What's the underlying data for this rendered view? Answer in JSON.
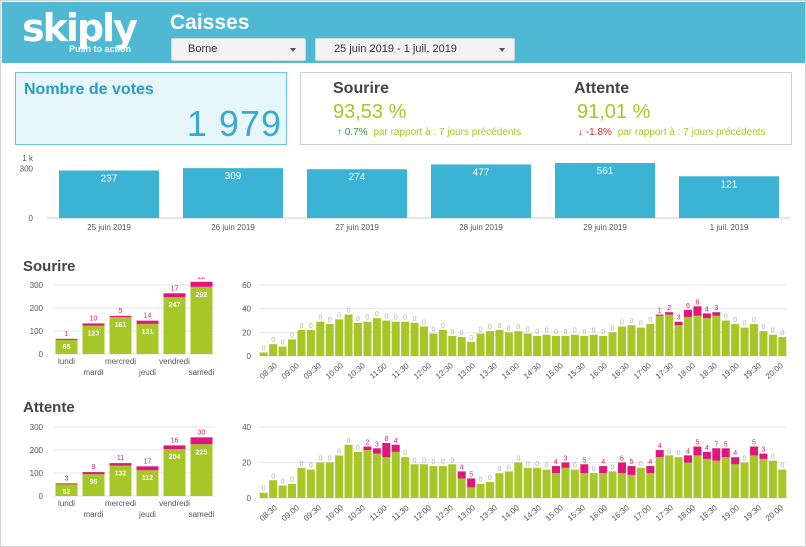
{
  "header": {
    "logo_text": "skiply",
    "logo_tagline": "Push to action",
    "title": "Caisses",
    "borne_dropdown": {
      "value": "Borne"
    },
    "date_dropdown": {
      "value": "25 juin 2019 - 1 juil. 2019"
    }
  },
  "votes_card": {
    "title": "Nombre de votes",
    "value": "1 979"
  },
  "kpis": {
    "sourire": {
      "title": "Sourire",
      "value": "93,53 %",
      "arrow": "↑",
      "delta": "0.7%",
      "comparison": "par rapport à : 7 jours précédents",
      "trend": "up"
    },
    "attente": {
      "title": "Attente",
      "value": "91,01 %",
      "arrow": "↓",
      "delta": "-1.8%",
      "comparison": "par rapport à : 7 jours précédents",
      "trend": "down"
    }
  },
  "sections": {
    "sourire_title": "Sourire",
    "attente_title": "Attente"
  },
  "colors": {
    "header_bg": "#4fb8d3",
    "blue_bar": "#3bb3d4",
    "positive_bar": "#a7c627",
    "negative_bar": "#e0177b",
    "axis_text": "#555555",
    "grid": "#e6e6e6"
  },
  "chart_data": [
    {
      "id": "daily",
      "type": "bar",
      "categories": [
        "25 juin 2019",
        "26 juin 2019",
        "27 juin 2019",
        "28 juin 2019",
        "29 juin 2019",
        "1 juil. 2019"
      ],
      "values": [
        237,
        309,
        274,
        477,
        561,
        121
      ],
      "y_ticks": [
        "0",
        "300",
        "1 k"
      ],
      "ylim": [
        0,
        1000
      ],
      "log_scale": true
    },
    {
      "id": "sourire_week",
      "type": "bar",
      "stacked": true,
      "categories": [
        "lundi",
        "mardi",
        "mercredi",
        "jeudi",
        "vendredi",
        "samedi"
      ],
      "series": [
        {
          "values": [
            65,
            123,
            161,
            131,
            247,
            292
          ]
        },
        {
          "values": [
            1,
            10,
            5,
            14,
            17,
            22
          ]
        }
      ],
      "y_ticks": [
        "0",
        "100",
        "200",
        "300"
      ],
      "ylim": [
        0,
        300
      ]
    },
    {
      "id": "sourire_hour",
      "type": "bar",
      "stacked": true,
      "x_tick_labels": [
        "08:30",
        "09:00",
        "09:30",
        "10:00",
        "10:30",
        "11:00",
        "11:30",
        "12:00",
        "12:30",
        "13:00",
        "13:30",
        "14:00",
        "14:30",
        "15:00",
        "15:30",
        "16:00",
        "16:30",
        "17:00",
        "17:30",
        "18:00",
        "18:30",
        "19:00",
        "19:30",
        "20:00"
      ],
      "series": [
        {
          "values": [
            3,
            10,
            8,
            14,
            22,
            22,
            29,
            27,
            31,
            35,
            28,
            29,
            32,
            30,
            29,
            29,
            28,
            25,
            19,
            22,
            17,
            16,
            12,
            19,
            21,
            22,
            20,
            21,
            19,
            17,
            18,
            17,
            17,
            18,
            17,
            18,
            17,
            20,
            25,
            26,
            24,
            27,
            34,
            35,
            26,
            33,
            34,
            32,
            34,
            30,
            27,
            24,
            27,
            21,
            18,
            16
          ]
        },
        {
          "values": [
            0,
            0,
            0,
            0,
            0,
            0,
            0,
            0,
            0,
            0,
            0,
            0,
            0,
            0,
            0,
            0,
            0,
            0,
            0,
            0,
            0,
            0,
            0,
            0,
            0,
            0,
            0,
            0,
            0,
            0,
            0,
            0,
            0,
            0,
            0,
            0,
            0,
            0,
            0,
            0,
            0,
            0,
            1,
            2,
            3,
            6,
            8,
            4,
            3,
            0,
            0,
            0,
            0,
            0,
            0,
            0
          ]
        }
      ],
      "y_ticks": [
        "0",
        "20",
        "40",
        "60"
      ],
      "ylim": [
        0,
        60
      ]
    },
    {
      "id": "attente_week",
      "type": "bar",
      "stacked": true,
      "categories": [
        "lundi",
        "mardi",
        "mercredi",
        "jeudi",
        "vendredi",
        "samedi"
      ],
      "series": [
        {
          "values": [
            52,
            95,
            132,
            112,
            204,
            225
          ]
        },
        {
          "values": [
            3,
            9,
            11,
            17,
            16,
            30
          ]
        }
      ],
      "y_ticks": [
        "0",
        "100",
        "200",
        "300"
      ],
      "ylim": [
        0,
        300
      ]
    },
    {
      "id": "attente_hour",
      "type": "bar",
      "stacked": true,
      "x_tick_labels": [
        "08:30",
        "09:00",
        "09:30",
        "10:00",
        "10:30",
        "11:00",
        "11:30",
        "12:00",
        "12:30",
        "13:00",
        "13:30",
        "14:00",
        "14:30",
        "15:00",
        "15:30",
        "16:00",
        "16:30",
        "17:00",
        "17:30",
        "18:00",
        "18:30",
        "19:00",
        "19:30",
        "20:00"
      ],
      "series": [
        {
          "values": [
            3,
            10,
            7,
            8,
            17,
            16,
            20,
            20,
            24,
            30,
            26,
            27,
            25,
            23,
            26,
            23,
            19,
            19,
            18,
            18,
            19,
            11,
            6,
            8,
            9,
            14,
            15,
            20,
            17,
            17,
            16,
            14,
            17,
            16,
            14,
            14,
            14,
            15,
            14,
            13,
            17,
            14,
            23,
            24,
            23,
            20,
            24,
            22,
            21,
            23,
            19,
            20,
            24,
            22,
            21,
            16
          ]
        },
        {
          "values": [
            0,
            0,
            0,
            0,
            0,
            0,
            0,
            0,
            0,
            0,
            0,
            2,
            3,
            8,
            4,
            0,
            0,
            0,
            0,
            0,
            0,
            4,
            5,
            0,
            0,
            0,
            0,
            0,
            0,
            0,
            0,
            4,
            3,
            0,
            5,
            0,
            4,
            0,
            6,
            5,
            0,
            4,
            4,
            0,
            0,
            4,
            5,
            4,
            7,
            5,
            4,
            0,
            5,
            3,
            0,
            0
          ]
        }
      ],
      "y_ticks": [
        "0",
        "20",
        "40"
      ],
      "ylim": [
        0,
        40
      ]
    }
  ]
}
